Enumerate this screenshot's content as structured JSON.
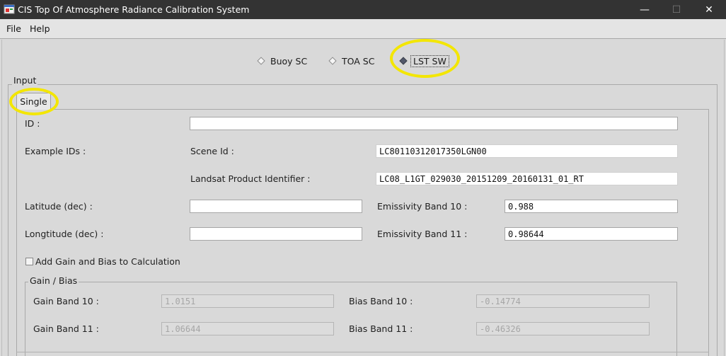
{
  "window": {
    "title": "CIS Top Of Atmosphere Radiance Calibration System",
    "minimize": "—",
    "maximize": "☐",
    "close": "✕"
  },
  "menu": {
    "file": "File",
    "help": "Help"
  },
  "mode_radio": {
    "options": [
      "Buoy SC",
      "TOA SC",
      "LST SW"
    ],
    "selected": "LST SW"
  },
  "input_group": {
    "legend": "Input",
    "tab": "Single"
  },
  "form": {
    "id_label": "ID :",
    "id_value": "",
    "example_ids_label": "Example IDs :",
    "scene_id_label": "Scene Id :",
    "scene_id_value": "LC80110312017350LGN00",
    "product_id_label": "Landsat Product Identifier :",
    "product_id_value": "LC08_L1GT_029030_20151209_20160131_01_RT",
    "latitude_label": "Latitude (dec) :",
    "latitude_value": "",
    "longitude_label": "Longtitude (dec) :",
    "longitude_value": "",
    "emissivity_b10_label": "Emissivity Band 10 :",
    "emissivity_b10_value": "0.988",
    "emissivity_b11_label": "Emissivity Band 11 :",
    "emissivity_b11_value": "0.98644",
    "gain_bias_checkbox_label": "Add Gain and Bias to Calculation",
    "gain_bias_checked": false
  },
  "gain_bias": {
    "legend": "Gain / Bias",
    "gain_b10_label": "Gain Band 10 :",
    "gain_b10_value": "1.0151",
    "gain_b11_label": "Gain Band 11 :",
    "gain_b11_value": "1.06644",
    "bias_b10_label": "Bias Band 10 :",
    "bias_b10_value": "-0.14774",
    "bias_b11_label": "Bias Band 11 :",
    "bias_b11_value": "-0.46326"
  },
  "colors": {
    "titlebar": "#333333",
    "background": "#d9d9d9",
    "highlight": "#f3e600",
    "radio_selected": "#53596b"
  },
  "icons": {
    "app": "app-window-icon",
    "radio_unselected": "diamond-empty-icon",
    "radio_selected": "diamond-filled-icon"
  }
}
